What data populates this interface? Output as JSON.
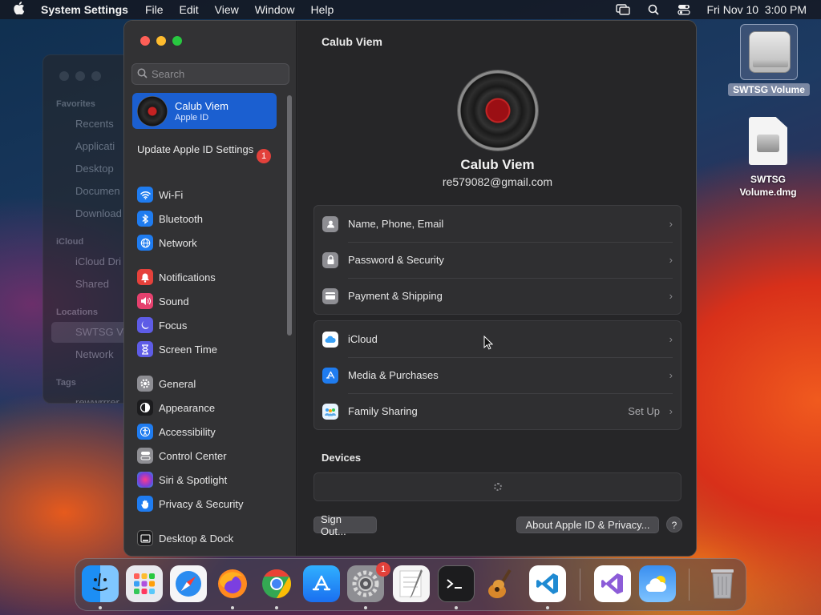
{
  "menubar": {
    "app_name": "System Settings",
    "menus": [
      "File",
      "Edit",
      "View",
      "Window",
      "Help"
    ],
    "clock": "Fri Nov 10  3:00 PM"
  },
  "finder": {
    "sections": [
      "Favorites",
      "iCloud",
      "Locations",
      "Tags"
    ],
    "items": [
      "Recents",
      "Applicati",
      "Desktop",
      "Documen",
      "Download",
      "iCloud Dri",
      "Shared",
      "SWTSG Vo",
      "Network",
      "rewwrrrer"
    ]
  },
  "desktop": {
    "drive_label": "SWTSG Volume",
    "dmg_label": "SWTSG Volume.dmg"
  },
  "sidebar": {
    "search_placeholder": "Search",
    "account_name": "Calub Viem",
    "account_sub": "Apple ID",
    "update_text": "Update Apple ID Settings",
    "update_badge": "1",
    "items": [
      {
        "label": "Wi-Fi",
        "icon": "wifi-icon",
        "color": "#1f7cf0"
      },
      {
        "label": "Bluetooth",
        "icon": "bluetooth-icon",
        "color": "#1f7cf0"
      },
      {
        "label": "Network",
        "icon": "globe-icon",
        "color": "#1f7cf0"
      },
      {
        "label": "Notifications",
        "icon": "bell-icon",
        "color": "#e5413b"
      },
      {
        "label": "Sound",
        "icon": "speaker-icon",
        "color": "#e5416e"
      },
      {
        "label": "Focus",
        "icon": "moon-icon",
        "color": "#5e5ce6"
      },
      {
        "label": "Screen Time",
        "icon": "hourglass-icon",
        "color": "#5e5ce6"
      },
      {
        "label": "General",
        "icon": "gear-icon",
        "color": "#8e8e93"
      },
      {
        "label": "Appearance",
        "icon": "appearance-icon",
        "color": "#1c1c1e"
      },
      {
        "label": "Accessibility",
        "icon": "accessibility-icon",
        "color": "#1f7cf0"
      },
      {
        "label": "Control Center",
        "icon": "control-center-icon",
        "color": "#8e8e93"
      },
      {
        "label": "Siri & Spotlight",
        "icon": "siri-icon",
        "color": "#7a3fd8"
      },
      {
        "label": "Privacy & Security",
        "icon": "hand-icon",
        "color": "#1f7cf0"
      },
      {
        "label": "Desktop & Dock",
        "icon": "dock-icon",
        "color": "#1c1c1e"
      }
    ]
  },
  "main": {
    "title": "Calub Viem",
    "profile_name": "Calub Viem",
    "profile_email": "re579082@gmail.com",
    "group1": [
      {
        "label": "Name, Phone, Email",
        "icon": "contact-icon",
        "color": "#8e8e93"
      },
      {
        "label": "Password & Security",
        "icon": "lock-icon",
        "color": "#8e8e93"
      },
      {
        "label": "Payment & Shipping",
        "icon": "card-icon",
        "color": "#8e8e93"
      }
    ],
    "group2": [
      {
        "label": "iCloud",
        "icon": "icloud-icon",
        "color": "#ffffff",
        "extra": ""
      },
      {
        "label": "Media & Purchases",
        "icon": "app-store-icon",
        "color": "#1f7cf0",
        "extra": ""
      },
      {
        "label": "Family Sharing",
        "icon": "family-icon",
        "color": "#e8f4ff",
        "extra": "Set Up"
      }
    ],
    "devices_title": "Devices",
    "sign_out": "Sign Out...",
    "about": "About Apple ID & Privacy...",
    "help": "?"
  },
  "dock": {
    "apps": [
      "Finder",
      "Launchpad",
      "Safari",
      "Firefox",
      "Chrome",
      "App Store",
      "System Settings",
      "TextEdit",
      "Terminal",
      "Instruments",
      "VS Code",
      "Visual Studio",
      "Weather",
      "Trash"
    ],
    "settings_badge": "1"
  }
}
